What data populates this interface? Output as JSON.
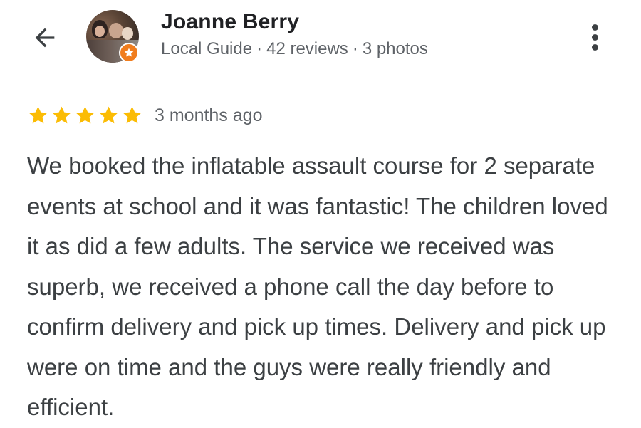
{
  "header": {
    "back_icon": "arrow-back-icon",
    "more_icon": "more-vert-icon"
  },
  "reviewer": {
    "name": "Joanne Berry",
    "level": "Local Guide",
    "separator": "·",
    "reviews": "42 reviews",
    "photos": "3 photos",
    "badge_icon": "local-guide-star-badge-icon",
    "badge_color": "#f07d1e"
  },
  "review": {
    "rating": 5,
    "rating_max": 5,
    "star_color": "#fbbc04",
    "time_ago": "3 months ago",
    "text": "We booked the inflatable assault course for 2 separate events at school and it was fantastic! The children loved it as did a few adults. The service we received was superb, we received a phone call the day before to confirm delivery and pick up times. Delivery and pick up were on time and the guys were really friendly and efficient."
  }
}
